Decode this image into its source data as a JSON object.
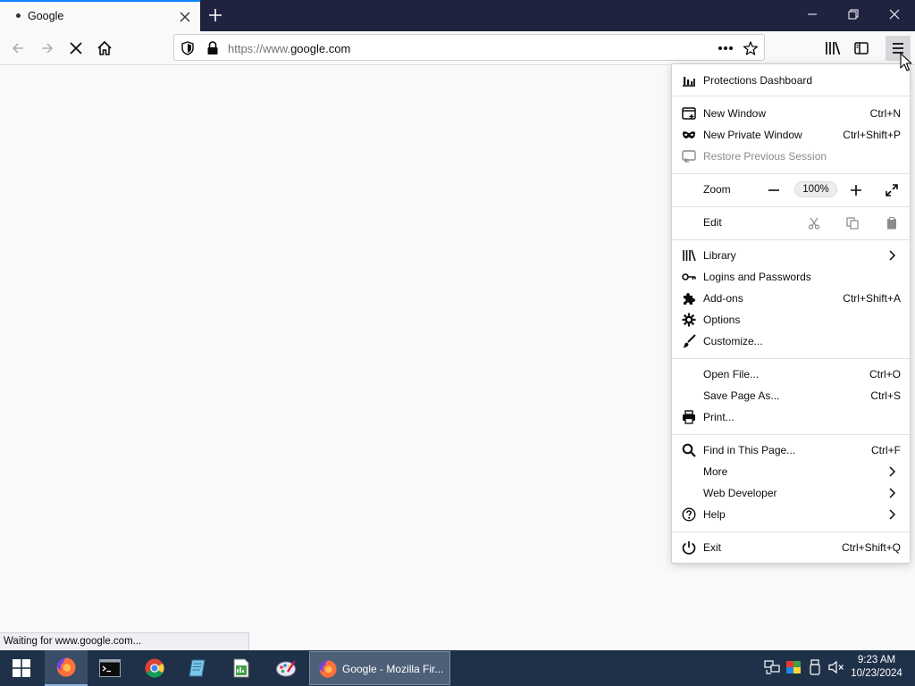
{
  "tab": {
    "title": "Google"
  },
  "urlbar": {
    "prefix": "https://www.",
    "domain": "google.com"
  },
  "status": {
    "text": "Waiting for www.google.com..."
  },
  "menu": {
    "protections": "Protections Dashboard",
    "new_window": {
      "label": "New Window",
      "shortcut": "Ctrl+N"
    },
    "new_private": {
      "label": "New Private Window",
      "shortcut": "Ctrl+Shift+P"
    },
    "restore": "Restore Previous Session",
    "zoom": {
      "label": "Zoom",
      "value": "100%"
    },
    "edit": "Edit",
    "library": "Library",
    "logins": "Logins and Passwords",
    "addons": {
      "label": "Add-ons",
      "shortcut": "Ctrl+Shift+A"
    },
    "options": "Options",
    "customize": "Customize...",
    "open_file": {
      "label": "Open File...",
      "shortcut": "Ctrl+O"
    },
    "save_page": {
      "label": "Save Page As...",
      "shortcut": "Ctrl+S"
    },
    "print": "Print...",
    "find": {
      "label": "Find in This Page...",
      "shortcut": "Ctrl+F"
    },
    "more": "More",
    "web_developer": "Web Developer",
    "help": "Help",
    "exit": {
      "label": "Exit",
      "shortcut": "Ctrl+Shift+Q"
    }
  },
  "taskbar": {
    "window_title": "Google - Mozilla Fir...",
    "time": "9:23 AM",
    "date": "10/23/2024"
  },
  "colors": {
    "accent": "#0a84ff",
    "titlebar": "#202340",
    "taskbar": "#1f3148"
  }
}
